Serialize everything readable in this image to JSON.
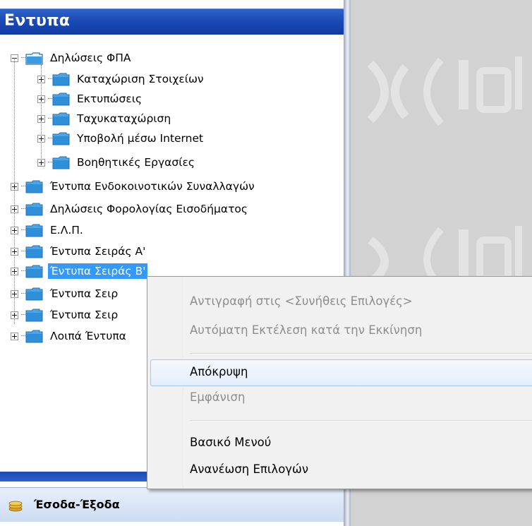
{
  "panel": {
    "title": "Εντυπα"
  },
  "tree": {
    "root": {
      "label": "Δηλώσεις ΦΠΑ",
      "expanded": true
    },
    "children": [
      {
        "label": "Καταχώριση Στοιχείων"
      },
      {
        "label": "Εκτυπώσεις"
      },
      {
        "label": "Ταχυκαταχώριση"
      },
      {
        "label": "Υποβολή μέσω Internet"
      },
      {
        "label": "Βοηθητικές Εργασίες"
      }
    ],
    "items": [
      {
        "label": "Έντυπα Ενδοκοινοτικών Συναλλαγών"
      },
      {
        "label": "Δηλώσεις Φορολογίας Εισοδήματος"
      },
      {
        "label": "Ε.Λ.Π."
      },
      {
        "label": "Έντυπα Σειράς Α'"
      },
      {
        "label": "Έντυπα Σειράς Β'",
        "selected": true
      },
      {
        "label": "Έντυπα Σειρ"
      },
      {
        "label": "Έντυπα Σειρ"
      },
      {
        "label": "Λοιπά Έντυπα"
      }
    ]
  },
  "footer": {
    "label": "Έσοδα-Έξοδα"
  },
  "context_menu": {
    "items": [
      {
        "label": "Αντιγραφή στις <Συνήθεις Επιλογές>",
        "enabled": false
      },
      {
        "label": "Αυτόματη Εκτέλεση κατά την Εκκίνηση",
        "enabled": false
      },
      {
        "label": "Απόκρυψη",
        "enabled": true,
        "hovered": true
      },
      {
        "label": "Εμφάνιση",
        "enabled": false
      },
      {
        "label": "Βασικό Μενού",
        "enabled": true
      },
      {
        "label": "Ανανέωση Επιλογών",
        "enabled": true
      }
    ]
  },
  "colors": {
    "header_blue": "#1a49b5",
    "selection": "#3399ff",
    "folder_blue": "#2f8fd8"
  }
}
